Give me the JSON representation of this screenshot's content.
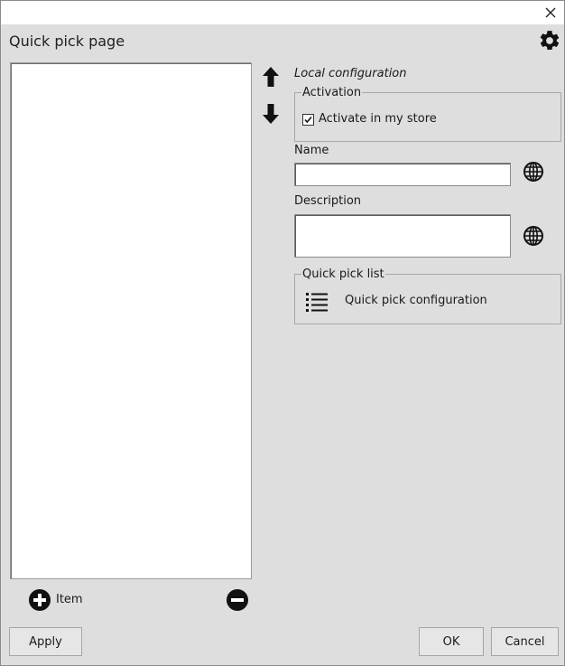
{
  "page": {
    "title": "Quick pick page"
  },
  "config": {
    "local_label": "Local configuration",
    "activation": {
      "group_title": "Activation",
      "checkbox_label": "Activate in my store",
      "checked": true
    },
    "name": {
      "label": "Name",
      "value": ""
    },
    "description": {
      "label": "Description",
      "value": ""
    },
    "quick_pick_list": {
      "group_title": "Quick pick list",
      "button_label": "Quick pick configuration"
    }
  },
  "list": {
    "items": [],
    "add_label": "Item"
  },
  "footer": {
    "apply_label": "Apply",
    "ok_label": "OK",
    "cancel_label": "Cancel"
  },
  "icons": {
    "close": "close-icon",
    "settings": "gear-icon",
    "move_up": "arrow-up-icon",
    "move_down": "arrow-down-icon",
    "translate": "globe-icon",
    "list": "list-icon",
    "add": "plus-circle-icon",
    "remove": "minus-circle-icon"
  }
}
